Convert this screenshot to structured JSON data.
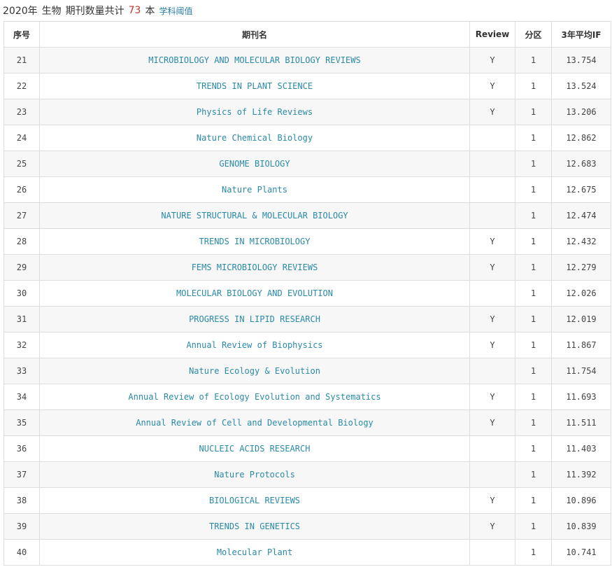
{
  "header": {
    "year_label": "2020年",
    "subject": "生物",
    "count_prefix": "期刊数量共计",
    "count": "73",
    "count_suffix": "本",
    "threshold_link": "学科阈值"
  },
  "colors": {
    "link": "#2a8aa8",
    "count": "#c0392b",
    "border": "#dddddd",
    "stripe": "#f7f7f7"
  },
  "table": {
    "columns": [
      "序号",
      "期刊名",
      "Review",
      "分区",
      "3年平均IF"
    ],
    "rows": [
      {
        "idx": "21",
        "name": "MICROBIOLOGY AND MOLECULAR BIOLOGY REVIEWS",
        "review": "Y",
        "zone": "1",
        "if": "13.754"
      },
      {
        "idx": "22",
        "name": "TRENDS IN PLANT SCIENCE",
        "review": "Y",
        "zone": "1",
        "if": "13.524"
      },
      {
        "idx": "23",
        "name": "Physics of Life Reviews",
        "review": "Y",
        "zone": "1",
        "if": "13.206"
      },
      {
        "idx": "24",
        "name": "Nature Chemical Biology",
        "review": "",
        "zone": "1",
        "if": "12.862"
      },
      {
        "idx": "25",
        "name": "GENOME BIOLOGY",
        "review": "",
        "zone": "1",
        "if": "12.683"
      },
      {
        "idx": "26",
        "name": "Nature Plants",
        "review": "",
        "zone": "1",
        "if": "12.675"
      },
      {
        "idx": "27",
        "name": "NATURE STRUCTURAL & MOLECULAR BIOLOGY",
        "review": "",
        "zone": "1",
        "if": "12.474"
      },
      {
        "idx": "28",
        "name": "TRENDS IN MICROBIOLOGY",
        "review": "Y",
        "zone": "1",
        "if": "12.432"
      },
      {
        "idx": "29",
        "name": "FEMS MICROBIOLOGY REVIEWS",
        "review": "Y",
        "zone": "1",
        "if": "12.279"
      },
      {
        "idx": "30",
        "name": "MOLECULAR BIOLOGY AND EVOLUTION",
        "review": "",
        "zone": "1",
        "if": "12.026"
      },
      {
        "idx": "31",
        "name": "PROGRESS IN LIPID RESEARCH",
        "review": "Y",
        "zone": "1",
        "if": "12.019"
      },
      {
        "idx": "32",
        "name": "Annual Review of Biophysics",
        "review": "Y",
        "zone": "1",
        "if": "11.867"
      },
      {
        "idx": "33",
        "name": "Nature Ecology & Evolution",
        "review": "",
        "zone": "1",
        "if": "11.754"
      },
      {
        "idx": "34",
        "name": "Annual Review of Ecology Evolution and Systematics",
        "review": "Y",
        "zone": "1",
        "if": "11.693"
      },
      {
        "idx": "35",
        "name": "Annual Review of Cell and Developmental Biology",
        "review": "Y",
        "zone": "1",
        "if": "11.511"
      },
      {
        "idx": "36",
        "name": "NUCLEIC ACIDS RESEARCH",
        "review": "",
        "zone": "1",
        "if": "11.403"
      },
      {
        "idx": "37",
        "name": "Nature Protocols",
        "review": "",
        "zone": "1",
        "if": "11.392"
      },
      {
        "idx": "38",
        "name": "BIOLOGICAL REVIEWS",
        "review": "Y",
        "zone": "1",
        "if": "10.896"
      },
      {
        "idx": "39",
        "name": "TRENDS IN GENETICS",
        "review": "Y",
        "zone": "1",
        "if": "10.839"
      },
      {
        "idx": "40",
        "name": "Molecular Plant",
        "review": "",
        "zone": "1",
        "if": "10.741"
      }
    ]
  }
}
